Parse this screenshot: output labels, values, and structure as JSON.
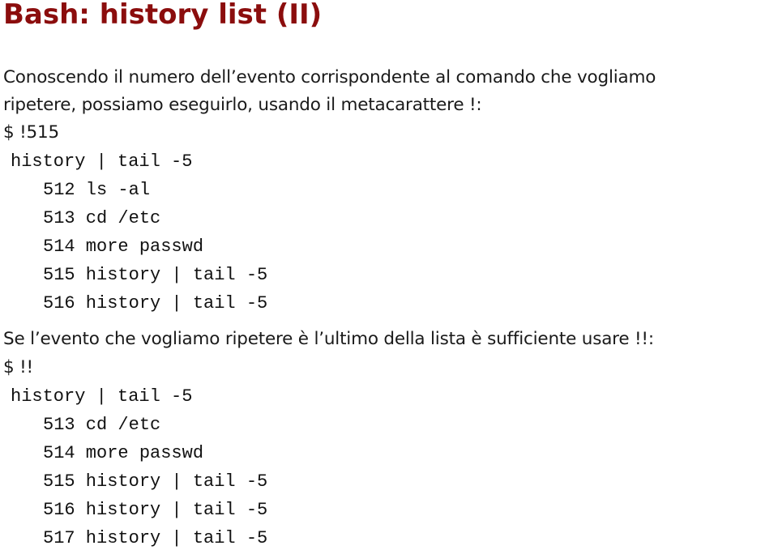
{
  "slide": {
    "title": "Bash: history list (II)",
    "title_color": "#8b0d0d",
    "paragraph1": [
      "Conoscendo il numero dell’evento corrispondente al comando che vogliamo",
      "ripetere, possiamo eseguirlo, usando il metacarattere !:"
    ],
    "prompt1": "$ !515",
    "example1": {
      "command": "history | tail -5",
      "output": [
        "512 ls -al",
        "513 cd /etc",
        "514 more passwd",
        "515 history | tail -5",
        "516 history | tail -5"
      ]
    },
    "paragraph2": "Se l’evento che vogliamo ripetere è l’ultimo della lista è sufficiente usare !!:",
    "prompt2": "$ !!",
    "example2": {
      "command": "history | tail -5",
      "output": [
        "513 cd /etc",
        "514 more passwd",
        "515 history | tail -5",
        "516 history | tail -5",
        "517 history | tail -5"
      ]
    }
  }
}
